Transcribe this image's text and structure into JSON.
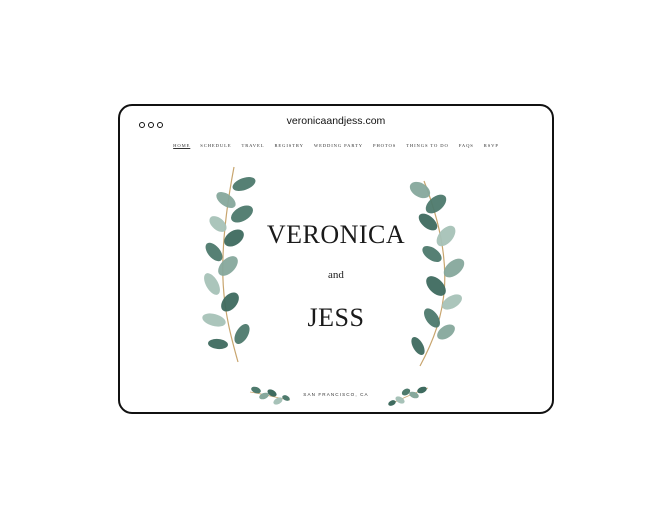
{
  "browser": {
    "url": "veronicaandjess.com"
  },
  "nav": {
    "items": [
      "HOME",
      "SCHEDULE",
      "TRAVEL",
      "REGISTRY",
      "WEDDING PARTY",
      "PHOTOS",
      "THINGS TO DO",
      "FAQS",
      "RSVP"
    ],
    "active": "HOME"
  },
  "hero": {
    "name1": "VERONICA",
    "connector": "and",
    "name2": "JESS",
    "location": "SAN FRANCISCO, CA"
  },
  "colors": {
    "leaf_dark": "#3f6b5f",
    "leaf_light": "#a7c2b8",
    "stem": "#c8a56e"
  }
}
